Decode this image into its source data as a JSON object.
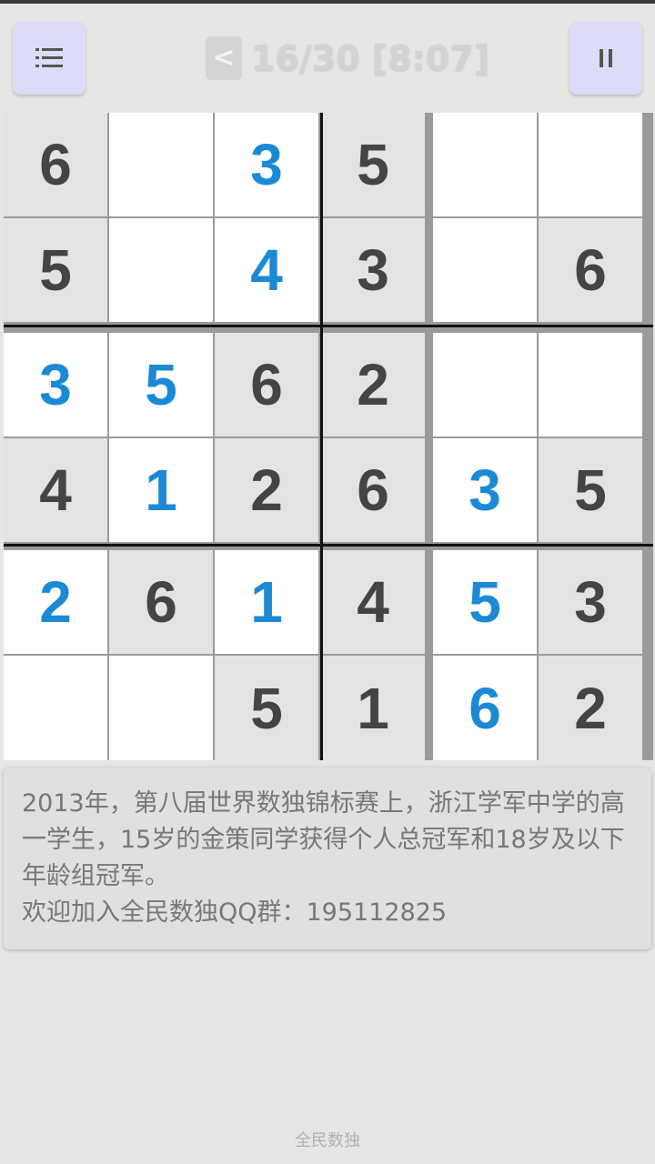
{
  "header": {
    "menu_icon": "list-icon",
    "back_label": "<",
    "progress": "16/30 [8:07]",
    "pause_icon": "pause-icon"
  },
  "board": {
    "size": 6,
    "cells": [
      [
        {
          "v": "6",
          "t": "given"
        },
        {
          "v": "",
          "t": "empty"
        },
        {
          "v": "3",
          "t": "filled"
        },
        {
          "v": "5",
          "t": "given"
        },
        {
          "v": "",
          "t": "empty"
        },
        {
          "v": "",
          "t": "empty"
        }
      ],
      [
        {
          "v": "5",
          "t": "given"
        },
        {
          "v": "",
          "t": "empty"
        },
        {
          "v": "4",
          "t": "filled"
        },
        {
          "v": "3",
          "t": "given"
        },
        {
          "v": "",
          "t": "empty"
        },
        {
          "v": "6",
          "t": "given"
        }
      ],
      [
        {
          "v": "3",
          "t": "filled"
        },
        {
          "v": "5",
          "t": "filled"
        },
        {
          "v": "6",
          "t": "given"
        },
        {
          "v": "2",
          "t": "given"
        },
        {
          "v": "",
          "t": "empty"
        },
        {
          "v": "",
          "t": "empty"
        }
      ],
      [
        {
          "v": "4",
          "t": "given"
        },
        {
          "v": "1",
          "t": "filled"
        },
        {
          "v": "2",
          "t": "given"
        },
        {
          "v": "6",
          "t": "given"
        },
        {
          "v": "3",
          "t": "filled"
        },
        {
          "v": "5",
          "t": "given"
        }
      ],
      [
        {
          "v": "2",
          "t": "filled"
        },
        {
          "v": "6",
          "t": "given"
        },
        {
          "v": "1",
          "t": "filled"
        },
        {
          "v": "4",
          "t": "given"
        },
        {
          "v": "5",
          "t": "filled"
        },
        {
          "v": "3",
          "t": "given"
        }
      ],
      [
        {
          "v": "",
          "t": "empty"
        },
        {
          "v": "",
          "t": "empty"
        },
        {
          "v": "5",
          "t": "given"
        },
        {
          "v": "1",
          "t": "given"
        },
        {
          "v": "6",
          "t": "filled"
        },
        {
          "v": "2",
          "t": "given"
        }
      ]
    ]
  },
  "tip": {
    "text": "2013年，第八届世界数独锦标赛上，浙江学军中学的高一学生，15岁的金策同学获得个人总冠军和18岁及以下年龄组冠军。\n欢迎加入全民数独QQ群：195112825"
  },
  "footer": {
    "app_name": "全民数独"
  },
  "colors": {
    "given_bg": "#e3e3e3",
    "given_text": "#444444",
    "filled_text": "#1b8ad6",
    "button_bg": "#dcdcf8"
  }
}
